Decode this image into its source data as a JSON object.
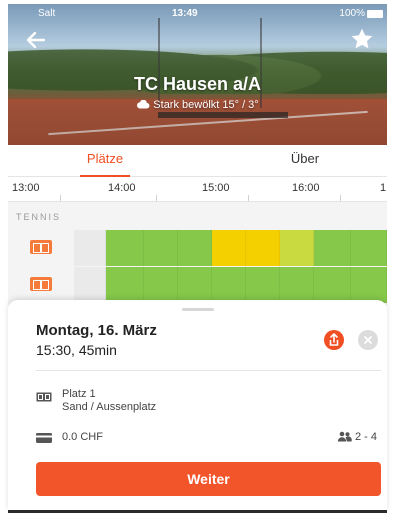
{
  "status_bar": {
    "carrier": "Salt",
    "time": "13:49",
    "battery": "100%"
  },
  "header": {
    "club_name": "TC Hausen a/A",
    "weather": "Stark bewölkt 15° / 3°"
  },
  "tabs": [
    {
      "label": "Plätze",
      "active": true
    },
    {
      "label": "Über",
      "active": false
    }
  ],
  "timeline": {
    "labels": [
      "13:00",
      "14:00",
      "15:00",
      "16:00",
      "1"
    ]
  },
  "grid": {
    "section_label": "TENNIS",
    "courts": [
      {
        "slots": [
          "empty",
          "free",
          "free",
          "free",
          "booked",
          "booked",
          "partial",
          "free",
          "free"
        ]
      },
      {
        "slots": [
          "empty",
          "free",
          "free",
          "free",
          "free",
          "free",
          "free",
          "free",
          "free"
        ]
      }
    ],
    "colors": {
      "free": "#86c94a",
      "booked": "#f5d000",
      "partial": "#c9d940",
      "empty": "#eaeaea"
    }
  },
  "booking": {
    "date": "Montag, 16. März",
    "time_duration": "15:30, 45min",
    "court_name": "Platz 1",
    "court_type": "Sand / Aussenplatz",
    "price": "0.0 CHF",
    "players": "2 - 4",
    "cta_label": "Weiter"
  },
  "colors": {
    "accent": "#f04e23"
  }
}
